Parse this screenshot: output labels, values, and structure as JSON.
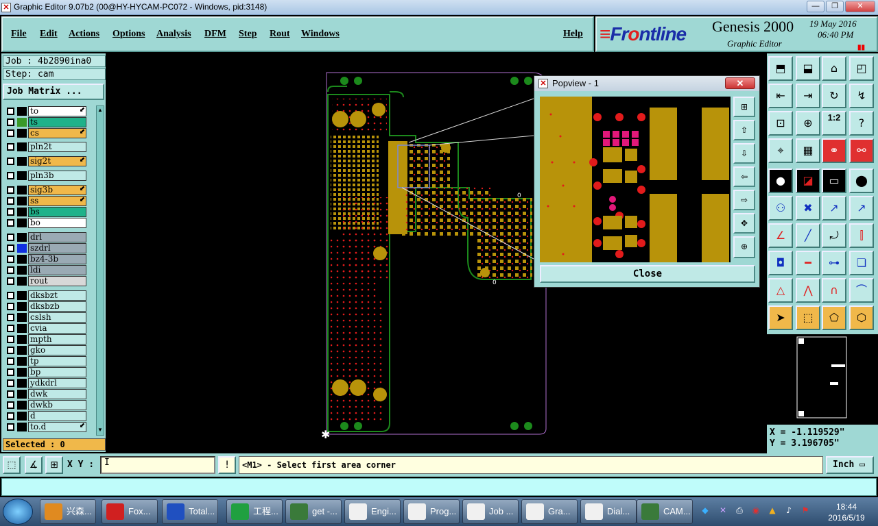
{
  "window": {
    "title": "Graphic Editor 9.07b2 (00@HY-HYCAM-PC072 - Windows, pid:3148)",
    "min": "—",
    "max": "❐",
    "close": "✕"
  },
  "menu": [
    "File",
    "Edit",
    "Actions",
    "Options",
    "Analysis",
    "DFM",
    "Step",
    "Rout",
    "Windows",
    "Help"
  ],
  "brand": {
    "logo_f": "Fr",
    "logo_o": "o",
    "logo_rest": "ntline",
    "product": "Genesis 2000",
    "subtitle": "Graphic Editor",
    "date": "19 May 2016",
    "time": "06:40 PM"
  },
  "job": {
    "job": "Job : 4b2890ina0",
    "step": "Step: cam",
    "job_matrix": "Job Matrix ..."
  },
  "layers": [
    {
      "name": "to",
      "color": "#ffffff",
      "swatch": "#000000",
      "arrow": true
    },
    {
      "name": "ts",
      "color": "#1fb28a",
      "swatch": "#3a9a2a",
      "arrow": false
    },
    {
      "name": "cs",
      "color": "#f0b84a",
      "swatch": "#000000",
      "arrow": true
    },
    {
      "name": "pln2t",
      "color": "#bfe9e6",
      "swatch": "#000000",
      "arrow": false
    },
    {
      "name": "sig2t",
      "color": "#f0b84a",
      "swatch": "#000000",
      "arrow": true
    },
    {
      "name": "pln3b",
      "color": "#bfe9e6",
      "swatch": "#000000",
      "arrow": false
    },
    {
      "name": "sig3b",
      "color": "#f0b84a",
      "swatch": "#000000",
      "arrow": true
    },
    {
      "name": "ss",
      "color": "#f0b84a",
      "swatch": "#000000",
      "arrow": true
    },
    {
      "name": "bs",
      "color": "#1fb28a",
      "swatch": "#000000",
      "arrow": false
    },
    {
      "name": "bo",
      "color": "#ffffff",
      "swatch": "#000000",
      "arrow": false
    },
    {
      "name": "drl",
      "color": "#9aaab4",
      "swatch": "#000000",
      "arrow": false
    },
    {
      "name": "szdrl",
      "color": "#9aaab4",
      "swatch": "#1030e0",
      "arrow": false
    },
    {
      "name": "bz4-3b",
      "color": "#9aaab4",
      "swatch": "#000000",
      "arrow": false
    },
    {
      "name": "ldi",
      "color": "#9aaab4",
      "swatch": "#000000",
      "arrow": false
    },
    {
      "name": "rout",
      "color": "#d8d8d8",
      "swatch": "#000000",
      "arrow": false
    },
    {
      "name": "dksbzt",
      "color": "#bfe9e6",
      "swatch": "#000000",
      "arrow": false
    },
    {
      "name": "dksbzb",
      "color": "#bfe9e6",
      "swatch": "#000000",
      "arrow": false
    },
    {
      "name": "cslsh",
      "color": "#bfe9e6",
      "swatch": "#000000",
      "arrow": false
    },
    {
      "name": "cvia",
      "color": "#bfe9e6",
      "swatch": "#000000",
      "arrow": false
    },
    {
      "name": "mpth",
      "color": "#bfe9e6",
      "swatch": "#000000",
      "arrow": false
    },
    {
      "name": "gko",
      "color": "#bfe9e6",
      "swatch": "#000000",
      "arrow": false
    },
    {
      "name": "tp",
      "color": "#bfe9e6",
      "swatch": "#000000",
      "arrow": false
    },
    {
      "name": "bp",
      "color": "#bfe9e6",
      "swatch": "#000000",
      "arrow": false
    },
    {
      "name": "ydkdrl",
      "color": "#bfe9e6",
      "swatch": "#000000",
      "arrow": false
    },
    {
      "name": "dwk",
      "color": "#bfe9e6",
      "swatch": "#000000",
      "arrow": false
    },
    {
      "name": "dwkb",
      "color": "#bfe9e6",
      "swatch": "#000000",
      "arrow": false
    },
    {
      "name": "d",
      "color": "#bfe9e6",
      "swatch": "#000000",
      "arrow": false
    },
    {
      "name": "to.d",
      "color": "#bfe9e6",
      "swatch": "#000000",
      "arrow": true
    }
  ],
  "selected": "Selected : 0",
  "popview": {
    "title": "Popview - 1",
    "close_label": "Close"
  },
  "coords": {
    "x": "X = -1.119529\"",
    "y": "Y = 3.196705\""
  },
  "bottom": {
    "xy_label": "X Y :",
    "prompt": "<M1> - Select first area corner",
    "unit": "Inch"
  },
  "taskbar": {
    "tasks": [
      {
        "label": "兴森...",
        "color": "#e08a20"
      },
      {
        "label": "Fox...",
        "color": "#d02020"
      },
      {
        "label": "Total...",
        "color": "#2050c0"
      },
      {
        "label": "工程...",
        "color": "#20a040"
      },
      {
        "label": "get -...",
        "color": "#3a7a3a"
      },
      {
        "label": "Engi...",
        "color": "#f0f0f0"
      },
      {
        "label": "Prog...",
        "color": "#f0f0f0"
      },
      {
        "label": "Job ...",
        "color": "#f0f0f0"
      },
      {
        "label": "Gra...",
        "color": "#f0f0f0"
      },
      {
        "label": "Dial...",
        "color": "#f0f0f0"
      },
      {
        "label": "CAM...",
        "color": "#3a7a3a"
      }
    ],
    "time": "18:44",
    "date": "2016/5/19"
  },
  "colors": {
    "panel": "#9fd8d4",
    "copper": "#b8930a",
    "pad": "#e21b1b",
    "outline": "#1c8a1c"
  }
}
